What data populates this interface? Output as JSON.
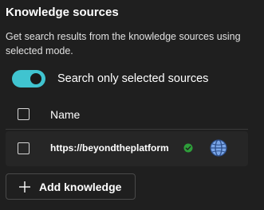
{
  "section": {
    "title": "Knowledge sources",
    "description": "Get search results from the knowledge sources using selected mode."
  },
  "toggle": {
    "label": "Search only selected sources",
    "on": true,
    "accent_color": "#40c4d0"
  },
  "table": {
    "header": "Name",
    "rows": [
      {
        "url": "https://beyondtheplatform",
        "status_icon": "check-circle-icon",
        "status_color": "#2e9e3a",
        "type_icon": "globe-icon"
      }
    ]
  },
  "add_button": {
    "label": "Add knowledge",
    "icon": "plus-icon"
  }
}
